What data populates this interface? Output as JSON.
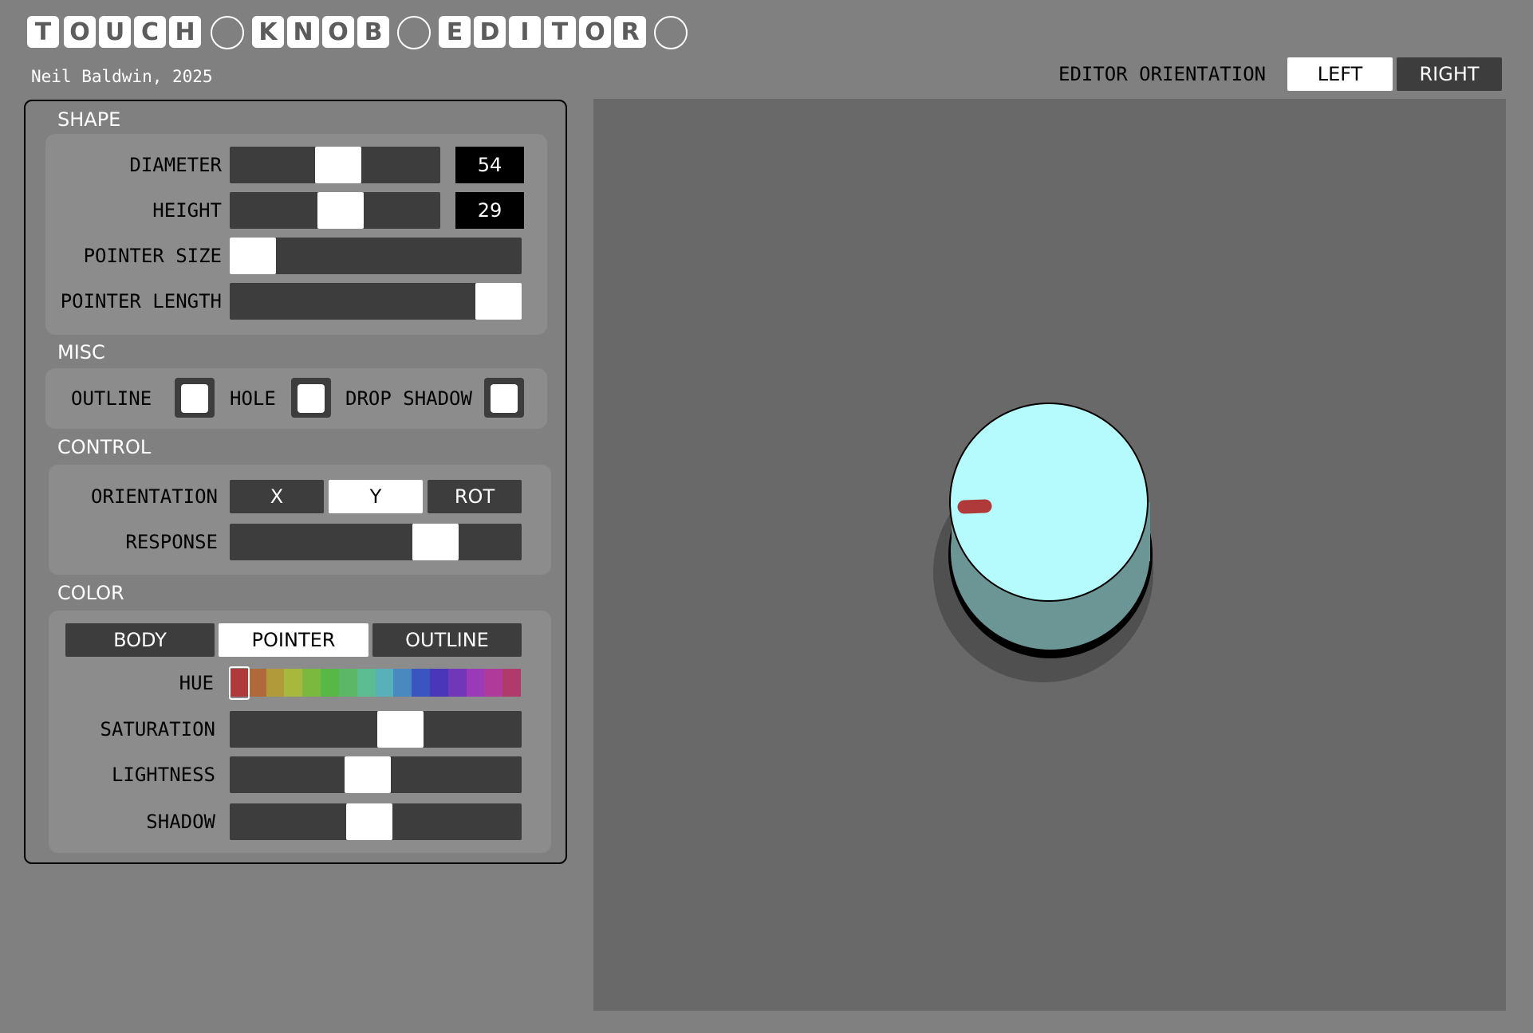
{
  "app": {
    "title_tiles": [
      {
        "char": "T"
      },
      {
        "char": "O"
      },
      {
        "char": "U"
      },
      {
        "char": "C"
      },
      {
        "char": "H"
      },
      {
        "char": ""
      },
      {
        "char": "K"
      },
      {
        "char": "N"
      },
      {
        "char": "O"
      },
      {
        "char": "B"
      },
      {
        "char": ""
      },
      {
        "char": "E"
      },
      {
        "char": "D"
      },
      {
        "char": "I"
      },
      {
        "char": "T"
      },
      {
        "char": "O"
      },
      {
        "char": "R"
      },
      {
        "char": ""
      }
    ],
    "author": "Neil Baldwin, 2025"
  },
  "editor_orientation": {
    "label": "EDITOR ORIENTATION",
    "options": [
      "LEFT",
      "RIGHT"
    ],
    "selected": "LEFT"
  },
  "shape": {
    "title": "SHAPE",
    "diameter": {
      "label": "DIAMETER",
      "value": "54",
      "level": 0.54
    },
    "height": {
      "label": "HEIGHT",
      "value": "29",
      "level": 0.55
    },
    "pointer_size": {
      "label": "POINTER SIZE",
      "level": 0.0
    },
    "pointer_length": {
      "label": "POINTER LENGTH",
      "level": 1.0
    }
  },
  "misc": {
    "title": "MISC",
    "outline": {
      "label": "OUTLINE",
      "checked": false
    },
    "hole": {
      "label": "HOLE",
      "checked": false
    },
    "drop_shadow": {
      "label": "DROP SHADOW",
      "checked": false
    }
  },
  "control": {
    "title": "CONTROL",
    "orientation": {
      "label": "ORIENTATION",
      "options": [
        "X",
        "Y",
        "ROT"
      ],
      "selected": "Y"
    },
    "response": {
      "label": "RESPONSE",
      "level": 0.78
    }
  },
  "color": {
    "title": "COLOR",
    "tabs": [
      "BODY",
      "POINTER",
      "OUTLINE"
    ],
    "selected_tab": "POINTER",
    "hue": {
      "label": "HUE",
      "selected_index": 0,
      "swatches": [
        "#b03a3a",
        "#b06a3a",
        "#b09a3a",
        "#a8b83e",
        "#7ab83e",
        "#58b846",
        "#5cb866",
        "#5cbc92",
        "#56b2b8",
        "#4a88c0",
        "#3a54c0",
        "#4a36b8",
        "#7038b8",
        "#9a3ab8",
        "#b03a9a",
        "#b03a6a"
      ]
    },
    "saturation": {
      "label": "SATURATION",
      "level": 0.58
    },
    "lightness": {
      "label": "LIGHTNESS",
      "level": 0.47
    },
    "shadow": {
      "label": "SHADOW",
      "level": 0.48
    }
  },
  "preview": {
    "knob_top_color": "#b5fbfd",
    "knob_side_color": "#6c9696",
    "pointer_color": "#b03a3a",
    "drop_shadow_color": "#505050"
  }
}
